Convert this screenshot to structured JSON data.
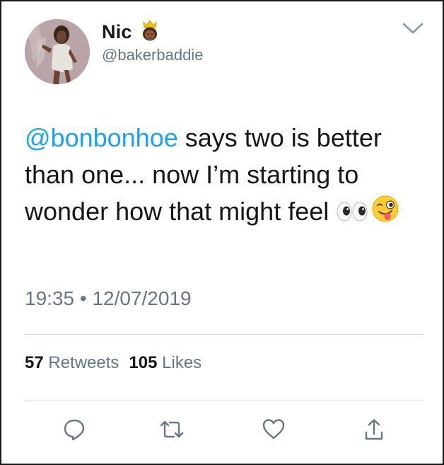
{
  "author": {
    "display_name": "Nic",
    "name_emoji": "crown-person-emoji",
    "handle": "@bakerbaddie",
    "avatar": "profile-photo"
  },
  "tweet": {
    "mention": "@bonbonhoe",
    "text": " says two is better than one... now I’m starting to wonder how that might feel ",
    "emojis": [
      "eyes-emoji",
      "winking-face-with-tongue-emoji"
    ],
    "time": "19:35",
    "separator": "•",
    "date": "12/07/2019"
  },
  "stats": {
    "retweets_count": "57",
    "retweets_label": "Retweets",
    "likes_count": "105",
    "likes_label": "Likes"
  },
  "actions": [
    "reply-icon",
    "retweet-icon",
    "like-icon",
    "share-icon"
  ],
  "colors": {
    "link": "#1da1f2",
    "secondary_text": "#657786",
    "primary_text": "#14171a",
    "divider": "#d9d9d9"
  }
}
